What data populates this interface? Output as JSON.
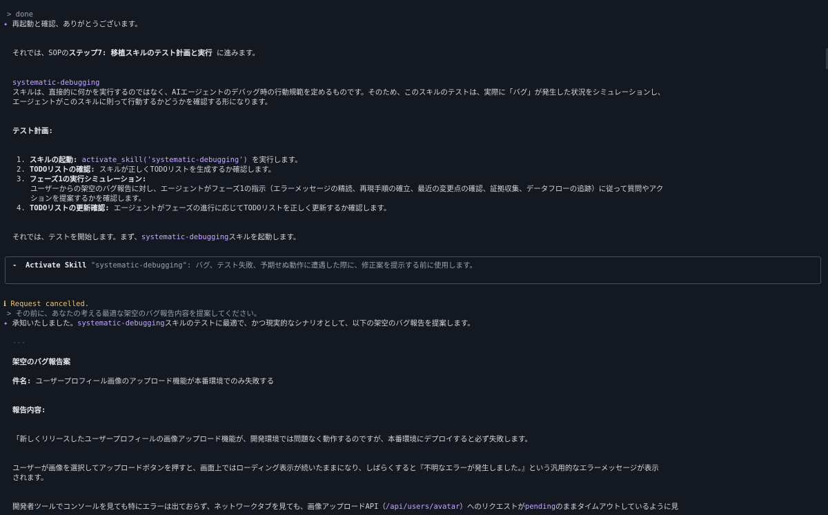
{
  "prev_command": "done",
  "assistant1": {
    "intro": "再起動と確認、ありがとうございます。",
    "step_pre": "それでは、SOPの",
    "step_bold": "ステップ7: 移植スキルのテスト計画と実行",
    "step_post": " に進みます。",
    "skill_name": "systematic-debugging",
    "desc_line1": "スキルは、直接的に何かを実行するのではなく、AIエージェントのデバッグ時の行動規範を定めるものです。そのため、このスキルのテストは、実際に「バグ」が発生した状況をシミュレーションし、",
    "desc_line2": "エージェントがこのスキルに則って行動するかどうかを確認する形になります。",
    "plan_heading": "テスト計画:",
    "plan": {
      "item1_num": "1.",
      "item1_bold": "スキルの起動:",
      "item1_code": "activate_skill('systematic-debugging')",
      "item1_post": " を実行します。",
      "item2_num": "2.",
      "item2_bold": "TODOリストの確認:",
      "item2_post": " スキルが正しくTODOリストを生成するか確認します。",
      "item3_num": "3.",
      "item3_bold": "フェーズ1の実行シミュレーション:",
      "item3_line1": "ユーザーからの架空のバグ報告に対し、エージェントがフェーズ1の指示（エラーメッセージの精読、再現手順の確立、最近の変更点の確認、証拠収集、データフローの追跡）に従って質問やアク",
      "item3_line2": "ションを提案するかを確認します。",
      "item4_num": "4.",
      "item4_bold": "TODOリストの更新確認:",
      "item4_post": " エージェントがフェーズの進行に応じてTODOリストを正しく更新するか確認します。"
    },
    "start_pre": "それでは、テストを開始します。まず、",
    "start_code": "systematic-debugging",
    "start_post": "スキルを起動します。"
  },
  "tool_call": {
    "dash": "-",
    "label": "Activate Skill",
    "args": "\"systematic-debugging\": バグ、テスト失敗、予期せぬ動作に遭遇した際に、修正案を提示する前に使用します。"
  },
  "cancel": {
    "icon": "ℹ",
    "text": "Request cancelled."
  },
  "user_prompt": "その前に、あなたの考える最適な架空のバグ報告内容を提案してください。",
  "assistant2": {
    "intro_pre": "承知いたしました。",
    "intro_code": "systematic-debugging",
    "intro_post": "スキルのテストに最適で、かつ現実的なシナリオとして、以下の架空のバグ報告を提案します。",
    "rule": "---",
    "heading": "架空のバグ報告案",
    "title_label": "件名:",
    "title_text": " ユーザープロフィール画像のアップロード機能が本番環境でのみ失敗する",
    "content_heading": "報告内容:",
    "para1": "「新しくリリースしたユーザープロフィールの画像アップロード機能が、開発環境では問題なく動作するのですが、本番環境にデプロイすると必ず失敗します。",
    "para2_line1": "ユーザーが画像を選択してアップロードボタンを押すと、画面上ではローディング表示が続いたままになり、しばらくすると『不明なエラーが発生しました。』という汎用的なエラーメッセージが表示",
    "para2_line2": "されます。",
    "para3_pre": "開発者ツールでコンソールを見ても特にエラーは出ておらず、ネットワークタブを見ても、画像アップロードAPI（",
    "para3_code": "/api/users/avatar",
    "para3_mid": "）へのリクエストが",
    "para3_code2": "pending",
    "para3_post": "のままタイムアウトしているように見"
  },
  "colors": {
    "background": "#141821",
    "text": "#d4d6dc",
    "accent": "#c3a6ff",
    "warning": "#e5c07b",
    "border": "#4a505c"
  }
}
